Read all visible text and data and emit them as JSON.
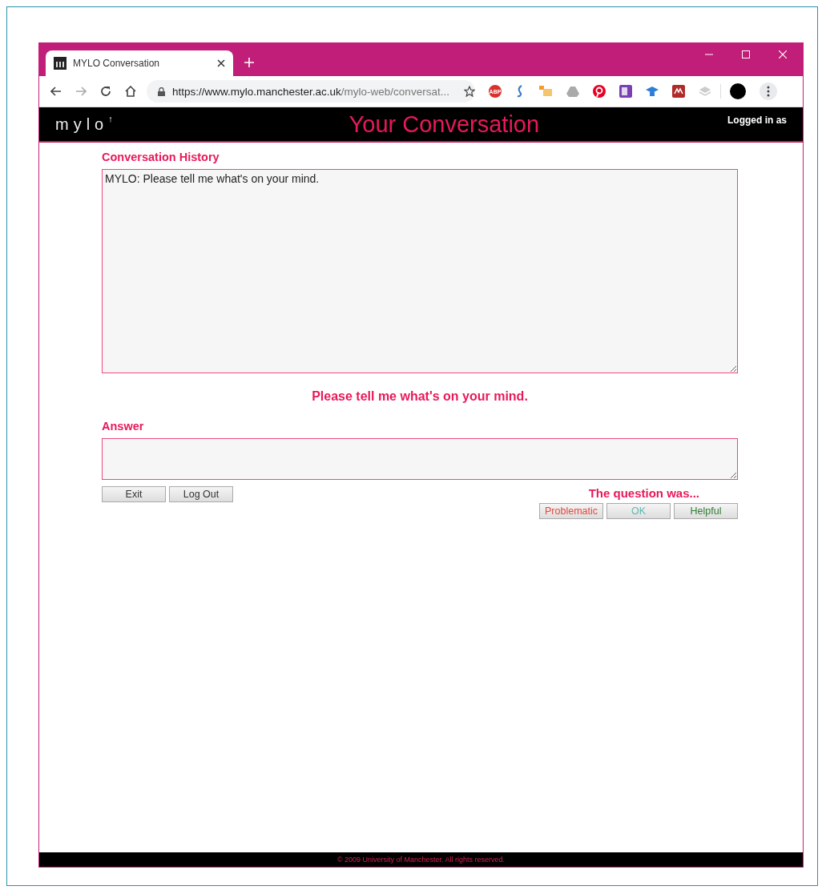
{
  "browser": {
    "tab_title": "MYLO Conversation",
    "url_host": "https://www.mylo.manchester.ac.uk",
    "url_path": "/mylo-web/conversat...",
    "abp_label": "ABP"
  },
  "header": {
    "logo": "mylo",
    "logo_mark": "↑",
    "title": "Your Conversation",
    "login": "Logged in as"
  },
  "history": {
    "label": "Conversation History",
    "value": "MYLO: Please tell me what's on your mind."
  },
  "prompt": "Please tell me what's on your mind.",
  "answer": {
    "label": "Answer"
  },
  "buttons": [
    "Exit",
    "Log Out"
  ],
  "rating": {
    "label": "The question was...",
    "options": [
      {
        "label": "Problematic",
        "color": "#e8463c"
      },
      {
        "label": "OK",
        "color": "#5fb8b0"
      },
      {
        "label": "Helpful",
        "color": "#2e7d32"
      }
    ]
  },
  "footer": "© 2009 University of Manchester. All rights reserved."
}
